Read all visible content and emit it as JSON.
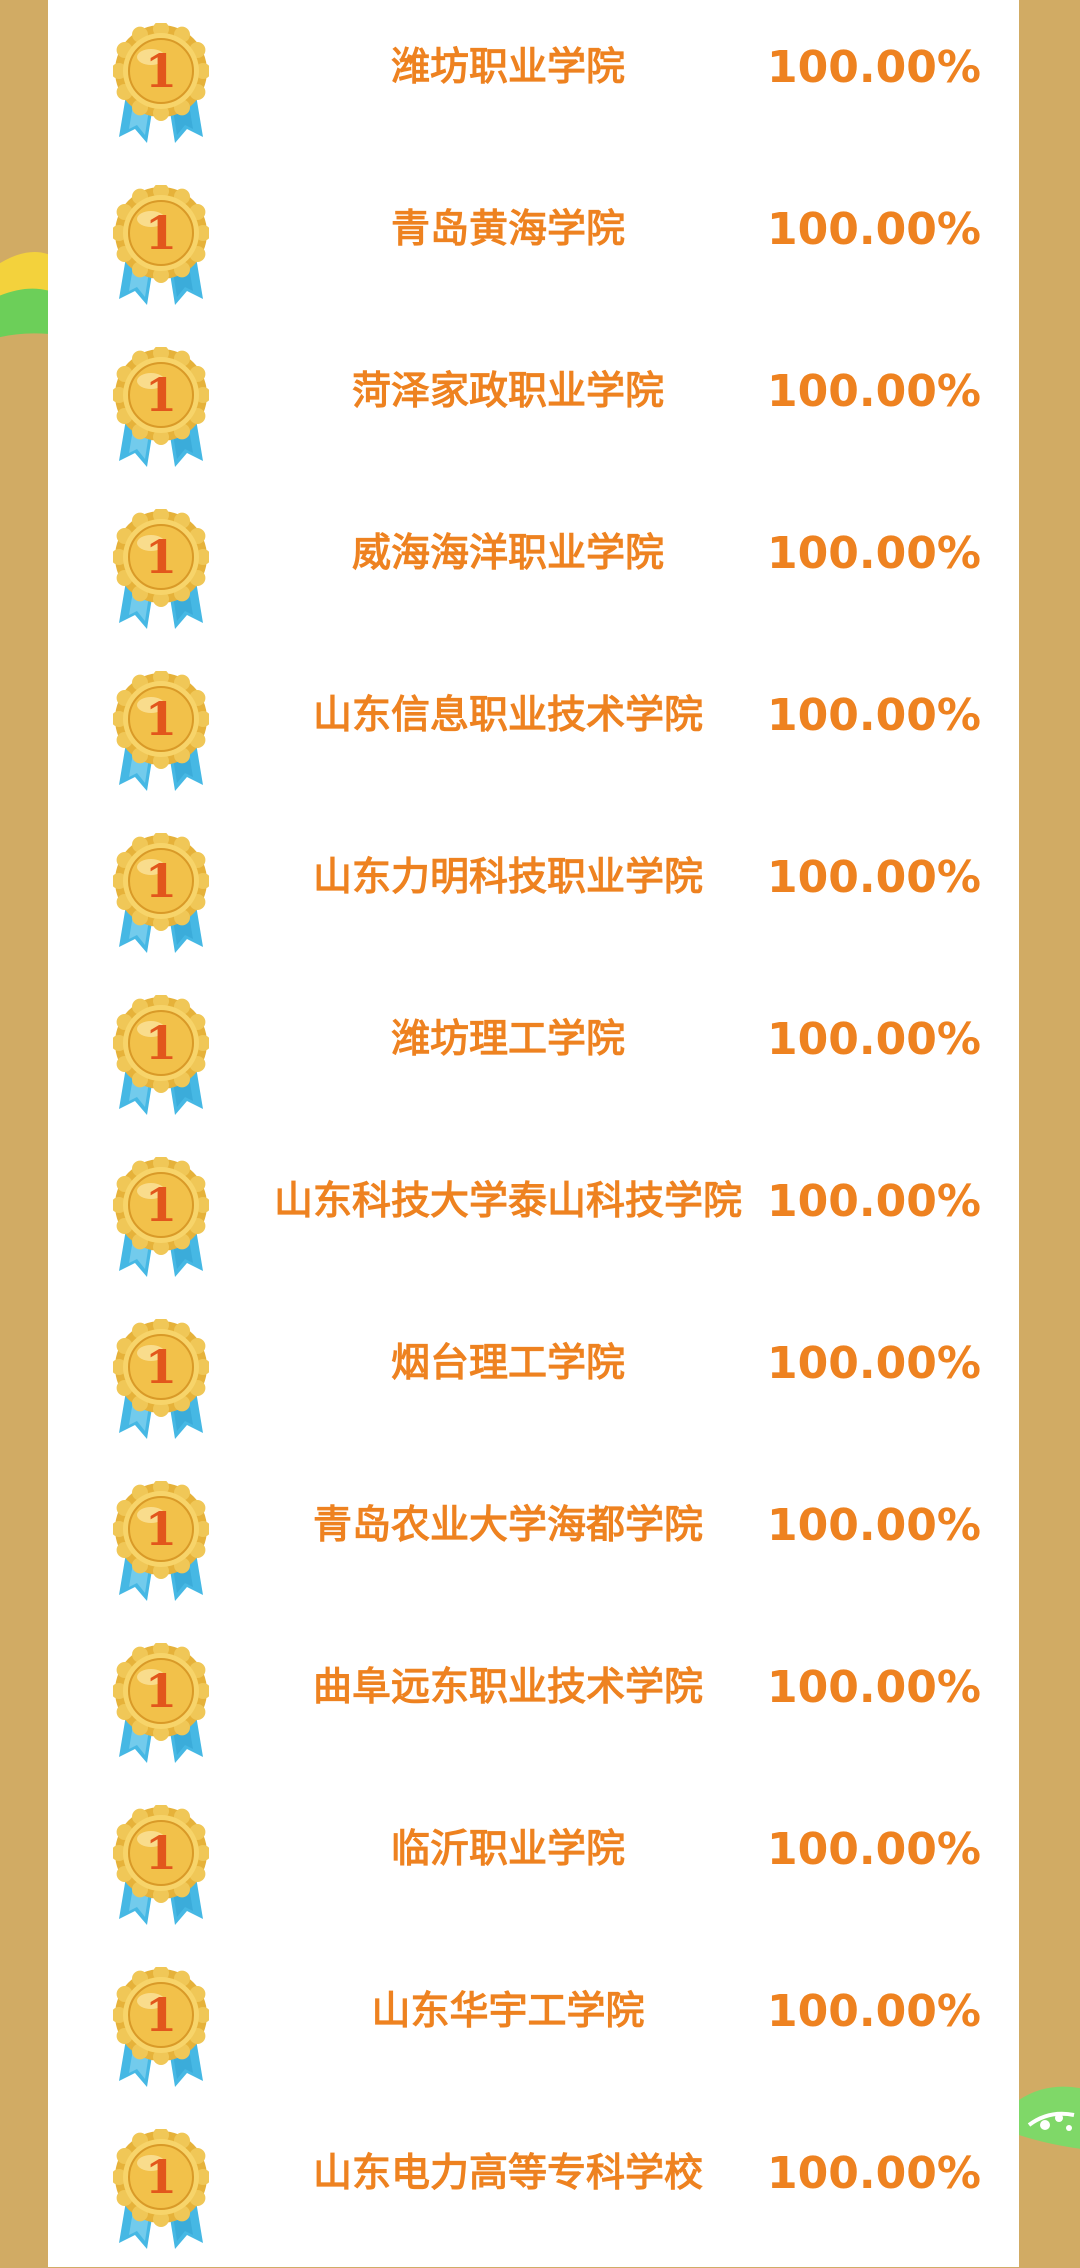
{
  "rows": [
    {
      "rank": "1",
      "school": "潍坊职业学院",
      "rate": "100.00%"
    },
    {
      "rank": "1",
      "school": "青岛黄海学院",
      "rate": "100.00%"
    },
    {
      "rank": "1",
      "school": "菏泽家政职业学院",
      "rate": "100.00%"
    },
    {
      "rank": "1",
      "school": "威海海洋职业学院",
      "rate": "100.00%"
    },
    {
      "rank": "1",
      "school": "山东信息职业技术学院",
      "rate": "100.00%"
    },
    {
      "rank": "1",
      "school": "山东力明科技职业学院",
      "rate": "100.00%"
    },
    {
      "rank": "1",
      "school": "潍坊理工学院",
      "rate": "100.00%"
    },
    {
      "rank": "1",
      "school": "山东科技大学泰山科技学院",
      "rate": "100.00%"
    },
    {
      "rank": "1",
      "school": "烟台理工学院",
      "rate": "100.00%"
    },
    {
      "rank": "1",
      "school": "青岛农业大学海都学院",
      "rate": "100.00%"
    },
    {
      "rank": "1",
      "school": "曲阜远东职业技术学院",
      "rate": "100.00%"
    },
    {
      "rank": "1",
      "school": "临沂职业学院",
      "rate": "100.00%"
    },
    {
      "rank": "1",
      "school": "山东华宇工学院",
      "rate": "100.00%"
    },
    {
      "rank": "1",
      "school": "山东电力高等专科学校",
      "rate": "100.00%"
    }
  ],
  "colors": {
    "background": "#d1ab64",
    "panel": "#ffffff",
    "text": "#ee8220",
    "medal_gold": "#f2c14a",
    "medal_digit": "#e2561c",
    "ribbon": "#46b8e4"
  },
  "icons": {
    "medal": "first-place-medal-icon"
  }
}
